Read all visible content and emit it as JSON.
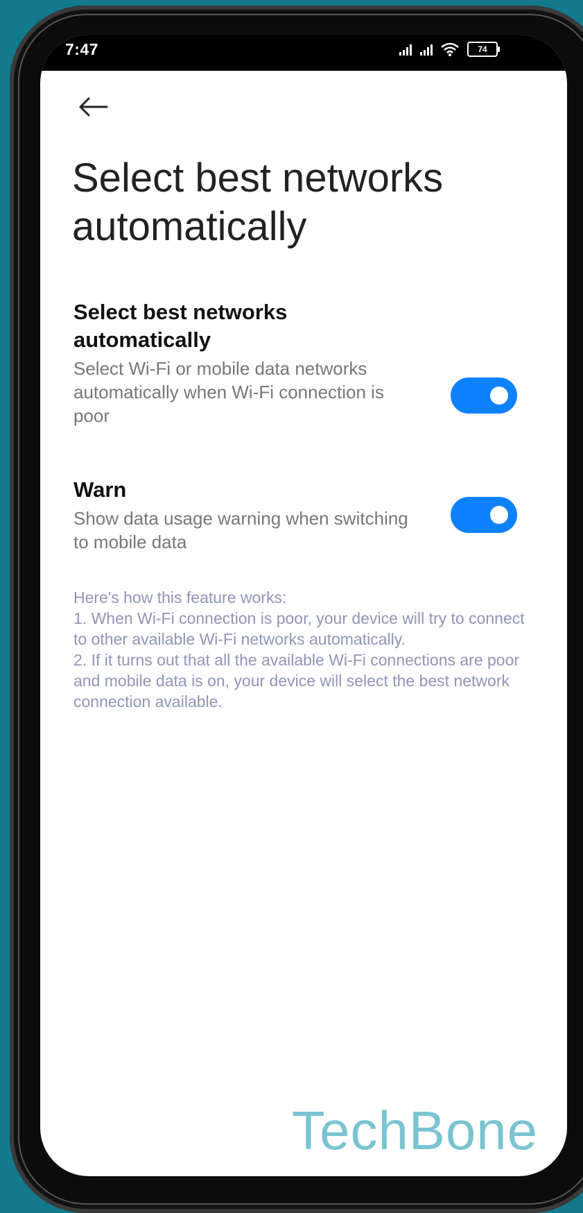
{
  "status_bar": {
    "time": "7:47",
    "battery": "74",
    "icons": [
      "signal-icon",
      "signal-icon",
      "wifi-icon",
      "battery-icon"
    ]
  },
  "header": {
    "back_icon": "arrow-left-icon",
    "title": "Select best networks automatically"
  },
  "settings": [
    {
      "title": "Select best networks automatically",
      "description": "Select Wi-Fi or mobile data networks automatically when Wi-Fi connection is poor",
      "enabled": true
    },
    {
      "title": "Warn",
      "description": "Show data usage warning when switching to mobile data",
      "enabled": true
    }
  ],
  "info": {
    "heading": "Here's how this feature works:",
    "lines": [
      "1. When Wi-Fi connection is poor, your device will try to connect to other available Wi-Fi networks automatically.",
      "2. If it turns out that all the available Wi-Fi connections are poor and mobile data is on, your device will select the best network connection available."
    ]
  },
  "watermark": "TechBone",
  "colors": {
    "accent": "#0d82ff",
    "background": "#127a8c",
    "info_text": "#8f95b8",
    "watermark": "#7ac4d1"
  }
}
